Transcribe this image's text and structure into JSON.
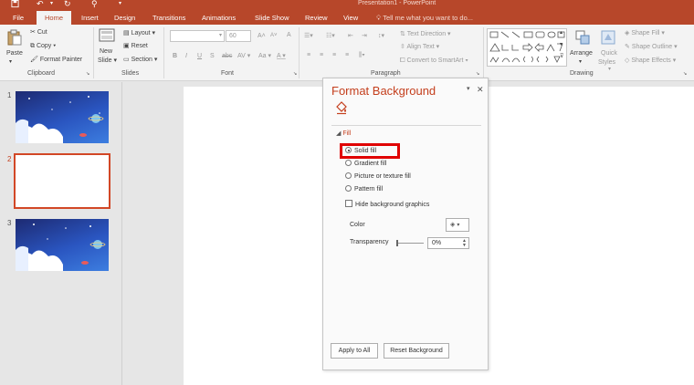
{
  "window": {
    "title": "Presentation1 - PowerPoint",
    "qat": {
      "save_icon": "save-icon",
      "undo_icon": "undo-icon",
      "redo_icon": "redo-icon",
      "present_icon": "present-from-start-icon",
      "more": "▾"
    }
  },
  "tabs": [
    "File",
    "Home",
    "Insert",
    "Design",
    "Transitions",
    "Animations",
    "Slide Show",
    "Review",
    "View"
  ],
  "active_tab": "Home",
  "tell_me": "Tell me what you want to do...",
  "ribbon": {
    "clipboard": {
      "paste": "Paste",
      "cut": "Cut",
      "copy": "Copy",
      "format_painter": "Format Painter",
      "label": "Clipboard"
    },
    "slides": {
      "new_slide_1": "New",
      "new_slide_2": "Slide",
      "layout": "Layout",
      "reset": "Reset",
      "section": "Section",
      "label": "Slides"
    },
    "font": {
      "font_size": "60",
      "bold": "B",
      "italic": "I",
      "underline": "U",
      "shadow": "S",
      "strike": "abc",
      "spacing": "AV",
      "case": "Aa",
      "color": "A",
      "grow": "A",
      "shrink": "A",
      "clear": "A",
      "label": "Font"
    },
    "paragraph": {
      "text_direction": "Text Direction",
      "align_text": "Align Text",
      "convert_smartart": "Convert to SmartArt",
      "label": "Paragraph"
    },
    "drawing": {
      "arrange": "Arrange",
      "quick_styles_1": "Quick",
      "quick_styles_2": "Styles",
      "shape_fill": "Shape Fill",
      "shape_outline": "Shape Outline",
      "shape_effects": "Shape Effects",
      "label": "Drawing"
    }
  },
  "slides": [
    {
      "number": "1",
      "kind": "space"
    },
    {
      "number": "2",
      "kind": "blank"
    },
    {
      "number": "3",
      "kind": "space"
    }
  ],
  "pane": {
    "title": "Format Background",
    "section": "Fill",
    "options": [
      {
        "label": "Solid fill",
        "selected": true
      },
      {
        "label": "Gradient fill",
        "selected": false
      },
      {
        "label": "Picture or texture fill",
        "selected": false
      },
      {
        "label": "Pattern fill",
        "selected": false
      }
    ],
    "hide_graphics": "Hide background graphics",
    "color_label": "Color",
    "transparency_label": "Transparency",
    "transparency_value": "0%",
    "apply_all": "Apply to All",
    "reset_background": "Reset Background"
  },
  "colors": {
    "accent": "#b7472a",
    "highlight": "#e00000",
    "title_red": "#c43e1c"
  }
}
